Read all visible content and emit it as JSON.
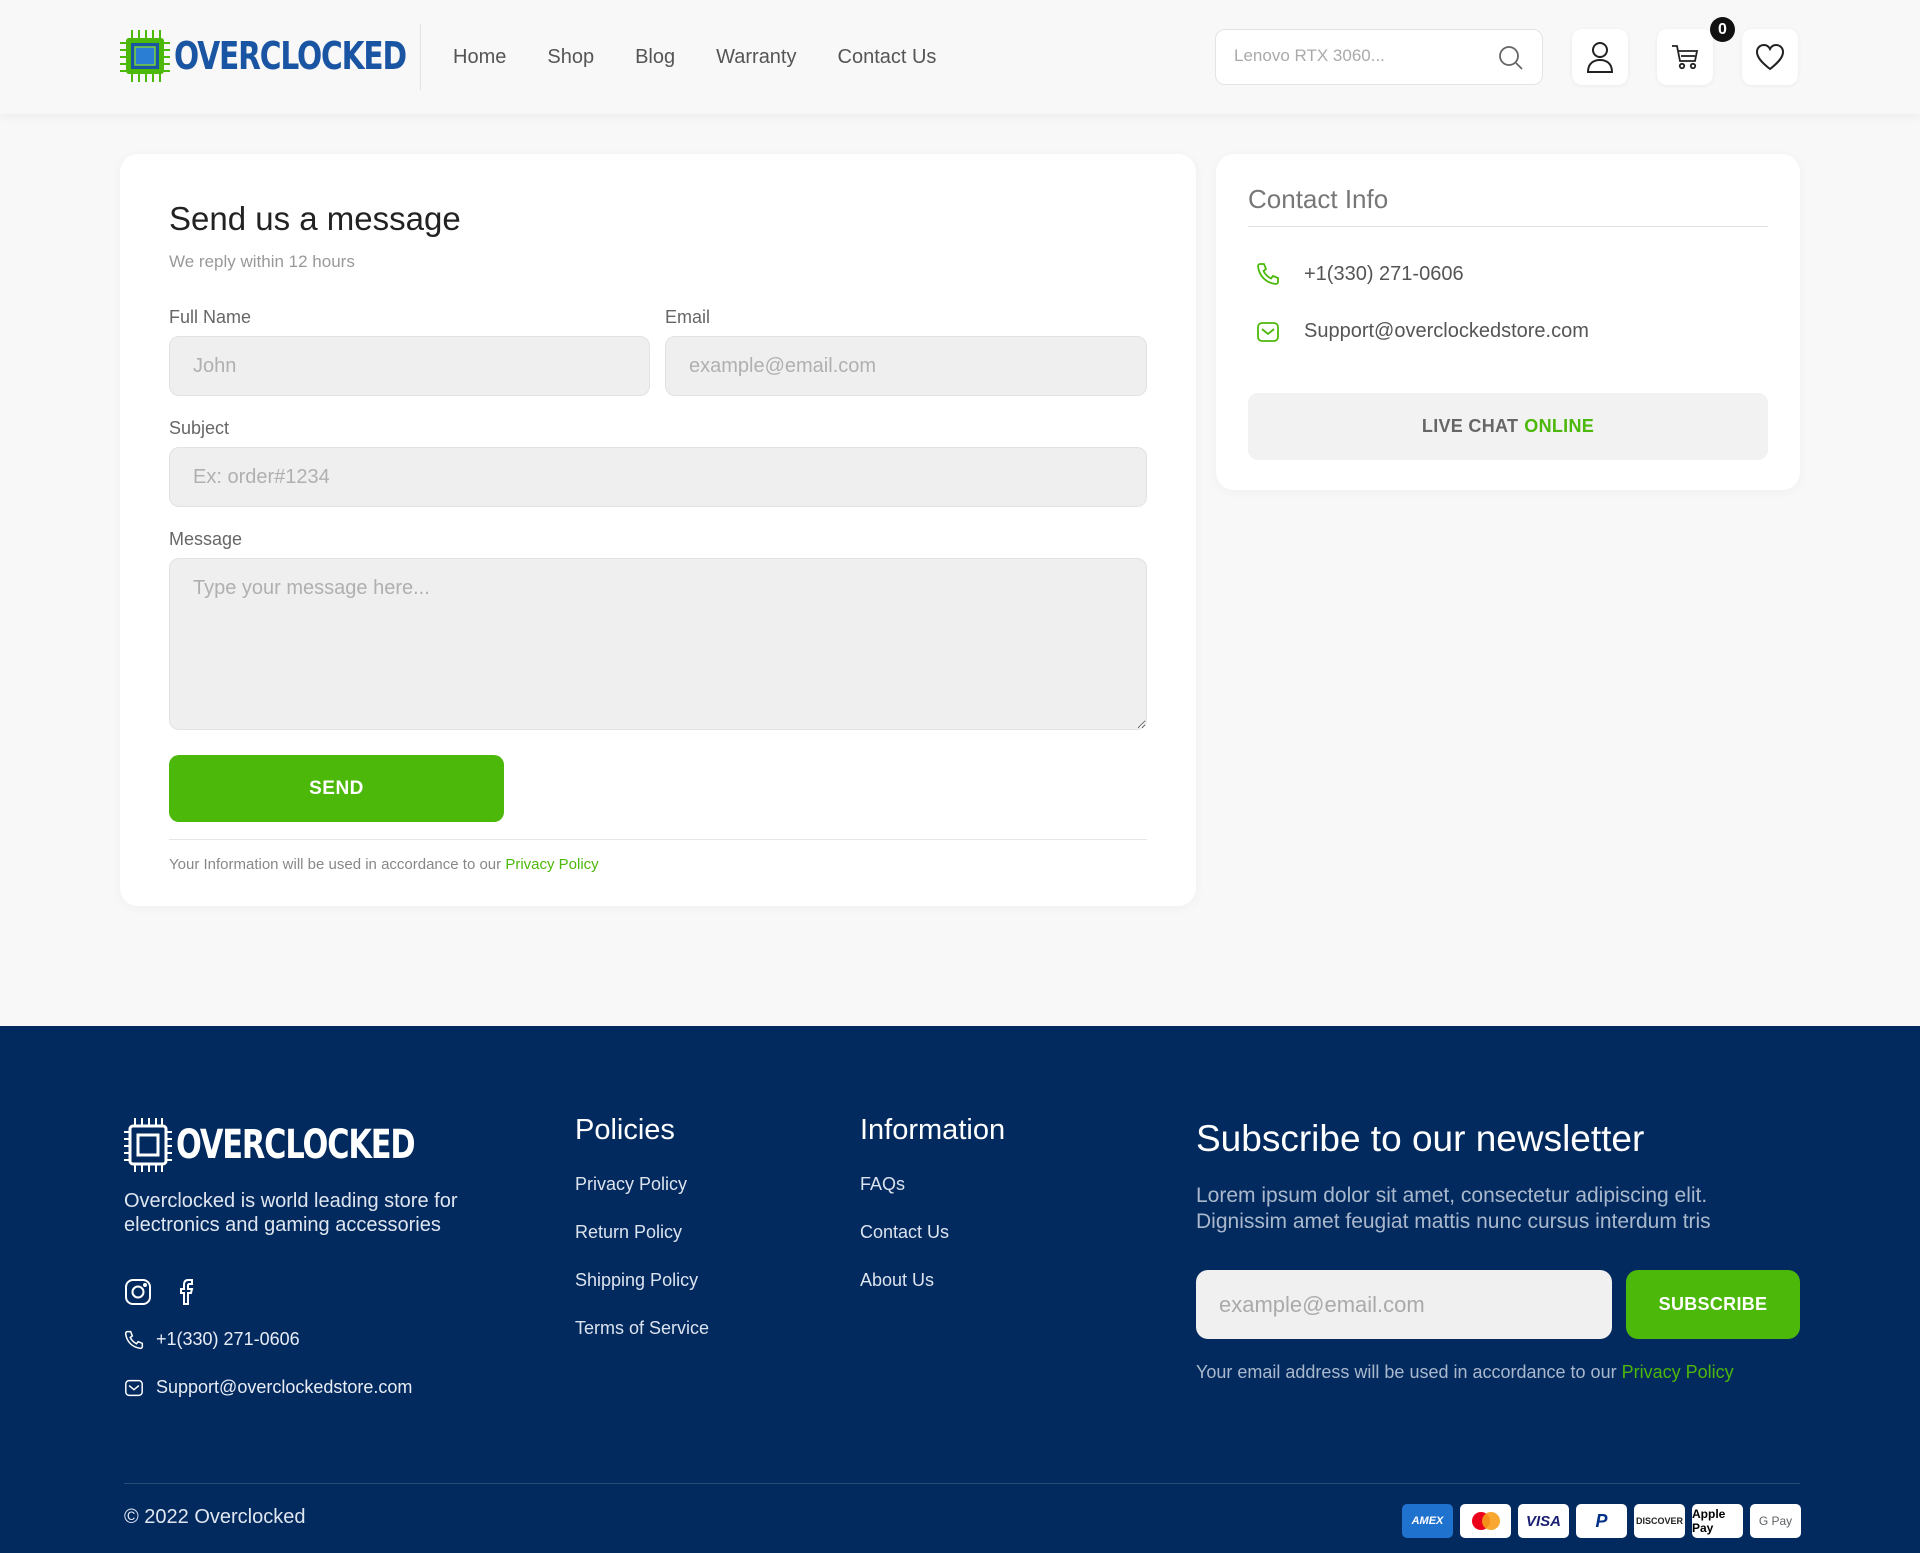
{
  "brand": {
    "name": "OVERCLOCKED",
    "accent": "#4cb80a",
    "primary": "#1a55a3",
    "footer_bg": "#032a5e"
  },
  "nav": {
    "items": [
      "Home",
      "Shop",
      "Blog",
      "Warranty",
      "Contact Us"
    ]
  },
  "search": {
    "placeholder": "Lenovo RTX 3060...",
    "icon": "search-icon"
  },
  "header_actions": {
    "account_icon": "user-icon",
    "cart_icon": "cart-icon",
    "cart_count": "0",
    "wishlist_icon": "heart-icon"
  },
  "form": {
    "title": "Send us a message",
    "subtitle": "We reply within 12 hours",
    "full_name_label": "Full Name",
    "full_name_placeholder": "John",
    "email_label": "Email",
    "email_placeholder": "example@email.com",
    "subject_label": "Subject",
    "subject_placeholder": "Ex: order#1234",
    "message_label": "Message",
    "message_placeholder": "Type your message here...",
    "send_label": "SEND",
    "note_prefix": "Your Information will be used in accordance to our",
    "note_link": "Privacy Policy"
  },
  "contact_info": {
    "title": "Contact Info",
    "phone": "+1(330) 271-0606",
    "email": "Support@overclockedstore.com",
    "live_chat_label": "LIVE CHAT",
    "live_chat_status": "ONLINE"
  },
  "footer": {
    "about": "Overclocked is world leading store for electronics and gaming accessories",
    "social": [
      "instagram-icon",
      "facebook-icon"
    ],
    "phone": "+1(330) 271-0606",
    "email": "Support@overclockedstore.com",
    "policies": {
      "title": "Policies",
      "links": [
        "Privacy Policy",
        "Return Policy",
        "Shipping Policy",
        "Terms of Service"
      ]
    },
    "information": {
      "title": "Information",
      "links": [
        "FAQs",
        "Contact Us",
        "About Us"
      ]
    },
    "newsletter": {
      "title": "Subscribe to our newsletter",
      "text": "Lorem ipsum dolor sit amet, consectetur adipiscing elit. Dignissim amet feugiat mattis nunc cursus interdum tris",
      "placeholder": "example@email.com",
      "button": "SUBSCRIBE",
      "note_prefix": "Your email address will be used in accordance to our",
      "note_link": "Privacy Policy"
    },
    "copyright": "© 2022 Overclocked",
    "payments": [
      "AMEX",
      "Mastercard",
      "VISA",
      "PayPal",
      "DISCOVER",
      "Apple Pay",
      "G Pay"
    ]
  }
}
